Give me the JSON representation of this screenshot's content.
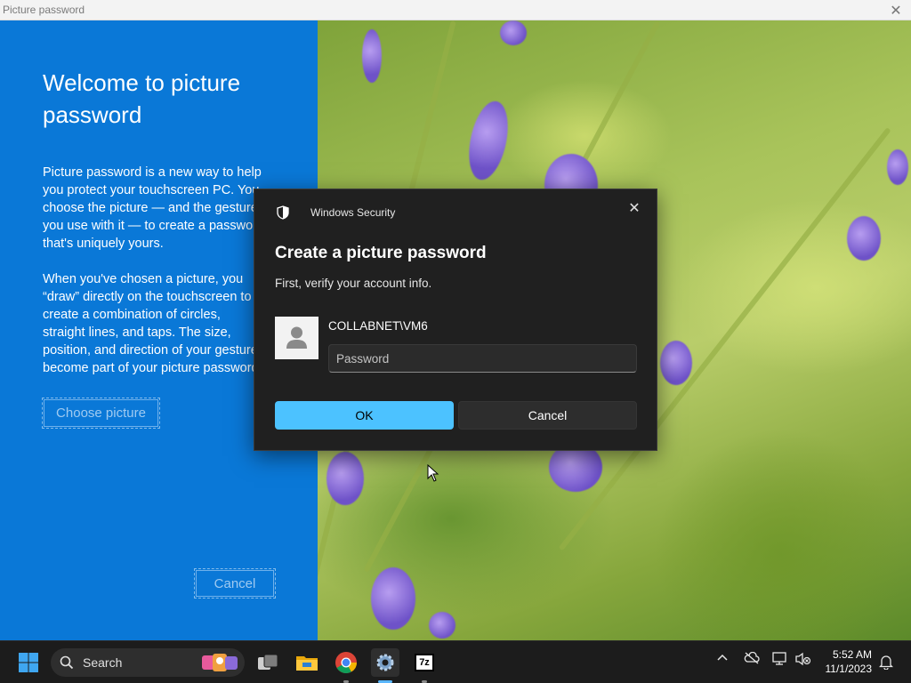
{
  "window": {
    "title": "Picture password"
  },
  "left_panel": {
    "heading": "Welcome to picture password",
    "paragraph1": "Picture password is a new way to help you protect your touchscreen PC. You choose the picture — and the gestures you use with it — to create a password that's uniquely yours.",
    "paragraph2": "When you've chosen a picture, you “draw” directly on the touchscreen to create a combination of circles, straight lines, and taps. The size, position, and direction of your gestures become part of your picture password.",
    "choose_button": "Choose picture",
    "cancel_button": "Cancel"
  },
  "dialog": {
    "app_name": "Windows Security",
    "heading": "Create a picture password",
    "subtitle": "First, verify your account info.",
    "account_name": "COLLABNET\\VM6",
    "password_placeholder": "Password",
    "password_value": "",
    "ok_label": "OK",
    "cancel_label": "Cancel"
  },
  "taskbar": {
    "search_label": "Search",
    "pinned": [
      "start-icon",
      "search-icon",
      "task-view-icon",
      "file-explorer-icon",
      "chrome-icon",
      "settings-icon",
      "7zip-icon"
    ],
    "seven_zip_label": "7z",
    "time": "5:52 AM",
    "date": "11/1/2023"
  },
  "colors": {
    "accent_blue": "#0a78d7",
    "ok_button": "#4cc2ff",
    "dialog_bg": "#202020",
    "taskbar_bg": "#1c1c1c"
  }
}
